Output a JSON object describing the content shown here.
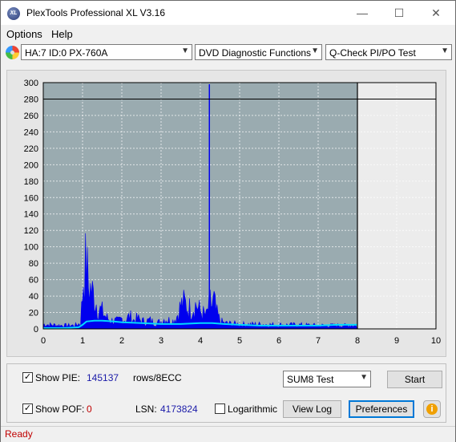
{
  "window": {
    "title": "PlexTools Professional XL V3.16",
    "icon_text": "XL"
  },
  "title_buttons": {
    "minimize": "—",
    "maximize": "☐",
    "close": "✕"
  },
  "menu": {
    "options": "Options",
    "help": "Help"
  },
  "toolbar": {
    "drive": "HA:7 ID:0  PX-760A",
    "function": "DVD Diagnostic Functions",
    "test": "Q-Check PI/PO Test"
  },
  "chart_data": {
    "type": "area",
    "xlim": [
      0,
      10
    ],
    "ylim": [
      0,
      300
    ],
    "x_ticks": [
      "0",
      "1",
      "2",
      "3",
      "4",
      "5",
      "6",
      "7",
      "8",
      "9",
      "10"
    ],
    "y_ticks": [
      "0",
      "20",
      "40",
      "60",
      "80",
      "100",
      "120",
      "140",
      "160",
      "180",
      "200",
      "220",
      "240",
      "260",
      "280",
      "300"
    ],
    "threshold_line": 280,
    "end_marker_x": 8,
    "colors": {
      "pie": "#0000ee",
      "sum8_line": "#00d8ff",
      "plot_bg": "#9aabb0",
      "empty_bg": "#ececec"
    },
    "series": [
      {
        "kind": "pie_envelope",
        "x": [
          0.0,
          0.2,
          0.5,
          0.8,
          0.95,
          1.0,
          1.02,
          1.05,
          1.1,
          1.15,
          1.2,
          1.3,
          1.4,
          1.5,
          1.6,
          1.7,
          1.8,
          1.9,
          2.0,
          2.1,
          2.2,
          2.3,
          2.4,
          2.5,
          2.6,
          2.7,
          2.8,
          2.9,
          3.0,
          3.1,
          3.2,
          3.3,
          3.4,
          3.5,
          3.6,
          3.7,
          3.8,
          3.9,
          4.0,
          4.1,
          4.15,
          4.2,
          4.25,
          4.3,
          4.35,
          4.4,
          4.5,
          4.6,
          4.8,
          5.0,
          5.5,
          6.0,
          6.5,
          7.0,
          7.5,
          8.0
        ],
        "y": [
          8,
          7,
          6,
          6,
          10,
          60,
          90,
          100,
          115,
          75,
          70,
          55,
          35,
          30,
          20,
          15,
          14,
          13,
          18,
          16,
          22,
          15,
          18,
          14,
          12,
          15,
          12,
          10,
          13,
          18,
          15,
          14,
          22,
          40,
          45,
          35,
          38,
          42,
          30,
          25,
          22,
          35,
          45,
          40,
          48,
          30,
          14,
          10,
          9,
          8,
          8,
          7,
          7,
          6,
          6,
          6
        ]
      },
      {
        "kind": "pie_spike",
        "x": [
          4.23
        ],
        "y": [
          298
        ]
      },
      {
        "kind": "sum8",
        "x": [
          0.0,
          0.5,
          0.9,
          1.0,
          1.1,
          1.3,
          1.5,
          1.8,
          2.0,
          2.5,
          3.0,
          3.5,
          4.0,
          4.3,
          4.6,
          5.0,
          5.5,
          6.0,
          6.5,
          7.0,
          7.5,
          8.0
        ],
        "y": [
          1,
          1,
          2,
          5,
          9,
          10,
          10,
          9,
          8,
          7,
          6,
          6,
          7,
          7,
          6,
          5,
          4,
          4,
          4,
          4,
          5,
          5
        ]
      }
    ]
  },
  "controls": {
    "show_pie_label": "Show PIE:",
    "pie_value": "145137",
    "pie_unit": "rows/8ECC",
    "show_pof_label": "Show POF:",
    "pof_value": "0",
    "lsn_label": "LSN:",
    "lsn_value": "4173824",
    "logarithmic_label": "Logarithmic",
    "test_select": "SUM8 Test",
    "start_button": "Start",
    "view_log_button": "View Log",
    "preferences_button": "Preferences",
    "info_icon": "i",
    "check_mark": "✓"
  },
  "status": {
    "text": "Ready"
  }
}
